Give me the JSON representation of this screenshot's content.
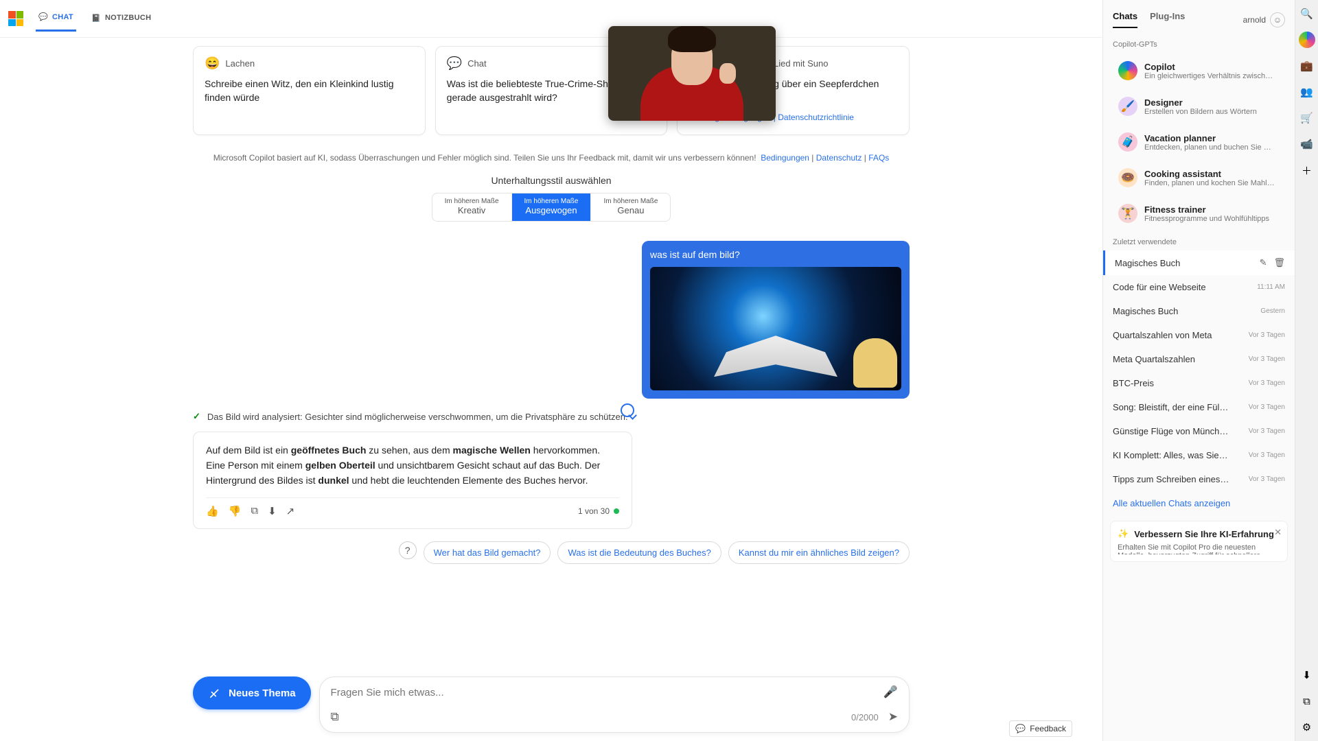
{
  "topbar": {
    "tabs": [
      {
        "label": "CHAT",
        "active": true
      },
      {
        "label": "NOTIZBUCH",
        "active": false
      }
    ]
  },
  "cards": [
    {
      "emoji": "😄",
      "category": "Lachen",
      "body": "Schreibe einen Witz, den ein Kleinkind lustig finden würde"
    },
    {
      "emoji": "💬",
      "category": "Chat",
      "body": "Was ist die beliebteste True-Crime-Show, die gerade ausgestrahlt wird?"
    },
    {
      "emoji": "🎵",
      "category": "Machen Sie ein Lied mit Suno",
      "body": "Mach einen Popsong über ein Seepferdchen namens Bubbles",
      "links": [
        "Nutzungsbedingungen",
        "Datenschutzrichtlinie"
      ]
    }
  ],
  "disclaimer": {
    "text": "Microsoft Copilot basiert auf KI, sodass Überraschungen und Fehler möglich sind. Teilen Sie uns Ihr Feedback mit, damit wir uns verbessern können!",
    "links": [
      "Bedingungen",
      "Datenschutz",
      "FAQs"
    ]
  },
  "style": {
    "title": "Unterhaltungsstil auswählen",
    "options": [
      {
        "sub": "Im höheren Maße",
        "main": "Kreativ",
        "selected": false
      },
      {
        "sub": "Im höheren Maße",
        "main": "Ausgewogen",
        "selected": true
      },
      {
        "sub": "Im höheren Maße",
        "main": "Genau",
        "selected": false
      }
    ]
  },
  "user_message": {
    "text": "was ist auf dem bild?"
  },
  "analysis": "Das Bild wird analysiert: Gesichter sind möglicherweise verschwommen, um die Privatsphäre zu schützen.",
  "ai_response": {
    "p1a": "Auf dem Bild ist ein ",
    "b1": "geöffnetes Buch",
    "p1b": " zu sehen, aus dem ",
    "b2": "magische Wellen",
    "p1c": " hervorkommen. Eine Person mit einem ",
    "b3": "gelben Oberteil",
    "p1d": " und unsichtbarem Gesicht schaut auf das Buch. Der Hintergrund des Bildes ist ",
    "b4": "dunkel",
    "p1e": " und hebt die leuchtenden Elemente des Buches hervor.",
    "counter": "1 von 30"
  },
  "suggestions": [
    "Wer hat das Bild gemacht?",
    "Was ist die Bedeutung des Buches?",
    "Kannst du mir ein ähnliches Bild zeigen?"
  ],
  "compose": {
    "new_topic": "Neues Thema",
    "placeholder": "Fragen Sie mich etwas...",
    "counter": "0/2000"
  },
  "sidebar": {
    "tabs": [
      "Chats",
      "Plug-Ins"
    ],
    "user": "arnold",
    "gpts_label": "Copilot-GPTs",
    "gpts": [
      {
        "icon": "copilot",
        "title": "Copilot",
        "sub": "Ein gleichwertiges Verhältnis zwischen KI und …"
      },
      {
        "icon": "designer",
        "title": "Designer",
        "sub": "Erstellen von Bildern aus Wörtern"
      },
      {
        "icon": "vacation",
        "title": "Vacation planner",
        "sub": "Entdecken, planen und buchen Sie Reisen"
      },
      {
        "icon": "cooking",
        "title": "Cooking assistant",
        "sub": "Finden, planen und kochen Sie Mahlzeiten"
      },
      {
        "icon": "fitness",
        "title": "Fitness trainer",
        "sub": "Fitnessprogramme und Wohlfühltipps"
      }
    ],
    "recent_label": "Zuletzt verwendete",
    "recent": [
      {
        "title": "Magisches Buch",
        "meta": "",
        "active": true
      },
      {
        "title": "Code für eine Webseite",
        "meta": "11:11 AM"
      },
      {
        "title": "Magisches Buch",
        "meta": "Gestern"
      },
      {
        "title": "Quartalszahlen von Meta",
        "meta": "Vor 3 Tagen"
      },
      {
        "title": "Meta Quartalszahlen",
        "meta": "Vor 3 Tagen"
      },
      {
        "title": "BTC-Preis",
        "meta": "Vor 3 Tagen"
      },
      {
        "title": "Song: Bleistift, der eine Füllfeder sein m…",
        "meta": "Vor 3 Tagen"
      },
      {
        "title": "Günstige Flüge von München nach Fra…",
        "meta": "Vor 3 Tagen"
      },
      {
        "title": "KI Komplett: Alles, was Sie über LLMs …",
        "meta": "Vor 3 Tagen"
      },
      {
        "title": "Tipps zum Schreiben eines Artikels übe…",
        "meta": "Vor 3 Tagen"
      }
    ],
    "all_chats": "Alle aktuellen Chats anzeigen",
    "promo": {
      "title": "Verbessern Sie Ihre KI-Erfahrung",
      "body": "Erhalten Sie mit Copilot Pro die neuesten Modelle, bevorzugten Zugriff für schnellere …"
    }
  },
  "feedback": "Feedback",
  "rail_icons": [
    "search",
    "copilot",
    "briefcase",
    "people",
    "cart",
    "video",
    "plus",
    "download",
    "popout",
    "settings"
  ]
}
